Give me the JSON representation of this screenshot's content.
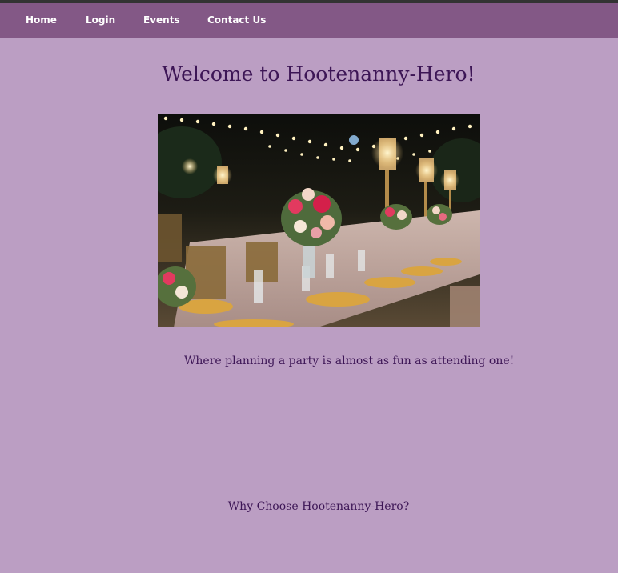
{
  "nav": {
    "items": [
      {
        "label": "Home"
      },
      {
        "label": "Login"
      },
      {
        "label": "Events"
      },
      {
        "label": "Contact Us"
      }
    ]
  },
  "main": {
    "title": "Welcome to Hootenanny-Hero!",
    "hero_image": "banquet-table-photo",
    "tagline": "Where planning a party is almost as fun as attending one!",
    "section_heading": "Why Choose Hootenanny-Hero?"
  },
  "colors": {
    "page_background": "#bb9ec3",
    "nav_background": "#835886",
    "heading_text": "#3d1656",
    "nav_text": "#ffffff"
  }
}
